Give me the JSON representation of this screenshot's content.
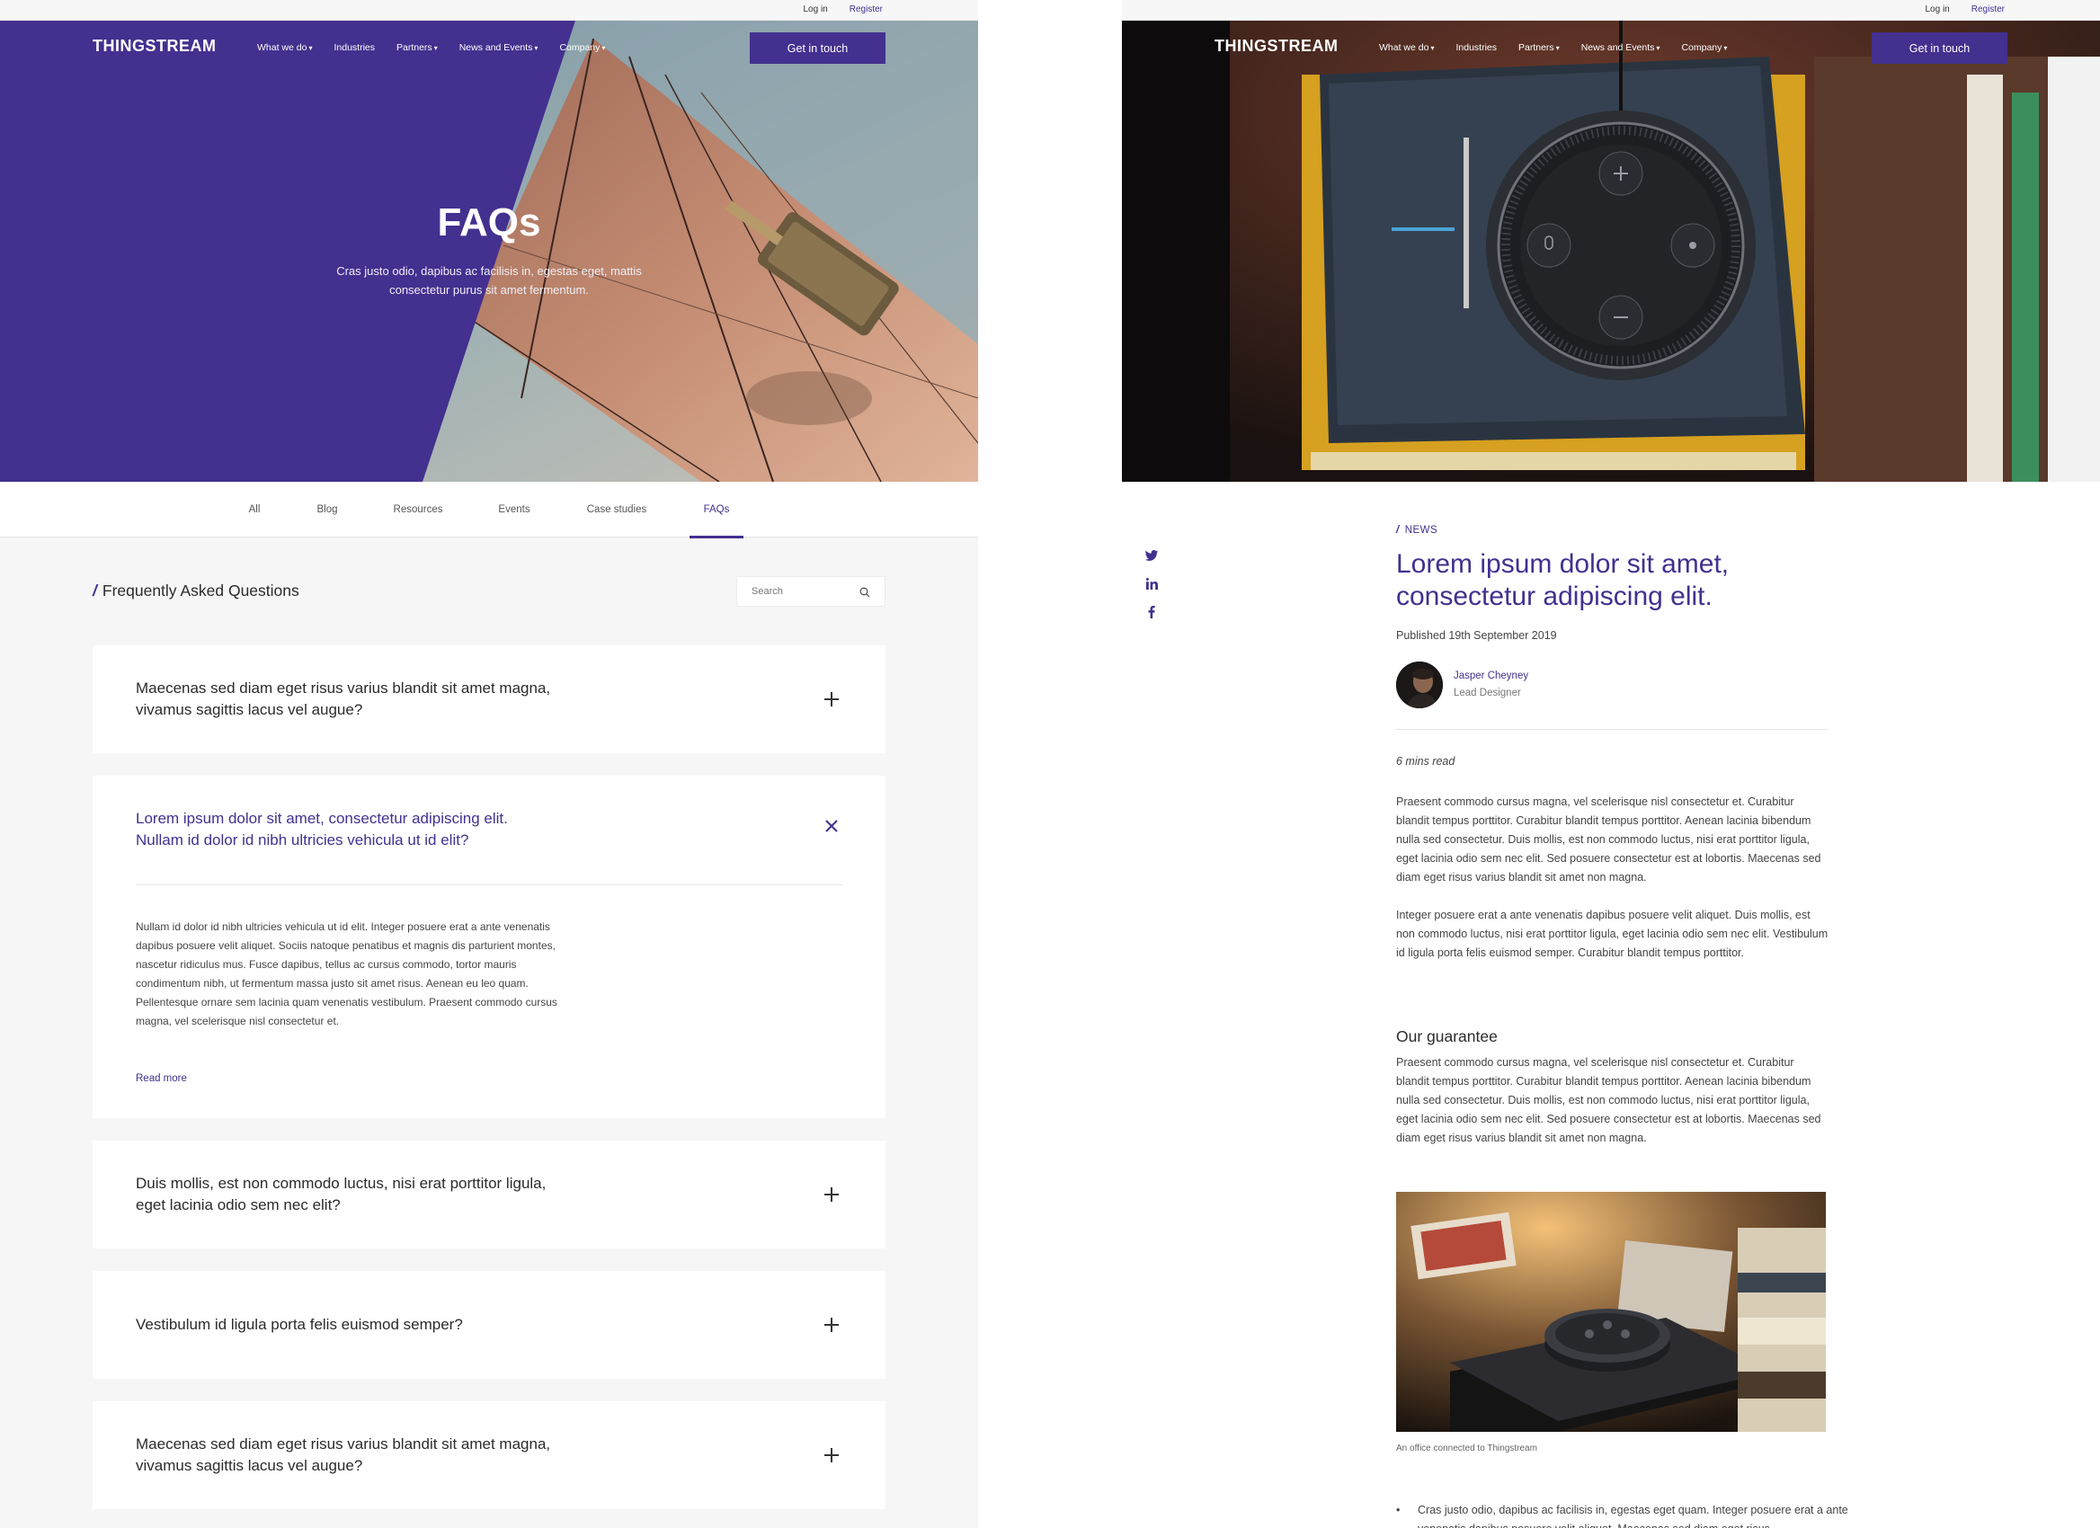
{
  "topbar": {
    "login": "Log in",
    "register": "Register"
  },
  "nav": {
    "logo": "THINGSTREAM",
    "items": [
      {
        "label": "What we do",
        "has_menu": true
      },
      {
        "label": "Industries",
        "has_menu": false
      },
      {
        "label": "Partners",
        "has_menu": true
      },
      {
        "label": "News and Events",
        "has_menu": true
      },
      {
        "label": "Company",
        "has_menu": true
      }
    ],
    "cta": "Get in touch"
  },
  "faq_page": {
    "hero": {
      "title": "FAQs",
      "subtitle": "Cras justo odio, dapibus ac facilisis in, egestas eget, mattis consectetur purus sit amet fermentum."
    },
    "tabs": [
      {
        "label": "All",
        "active": false
      },
      {
        "label": "Blog",
        "active": false
      },
      {
        "label": "Resources",
        "active": false
      },
      {
        "label": "Events",
        "active": false
      },
      {
        "label": "Case studies",
        "active": false
      },
      {
        "label": "FAQs",
        "active": true
      }
    ],
    "section_title": "Frequently Asked Questions",
    "search_placeholder": "Search",
    "items": [
      {
        "question": "Maecenas sed diam eget risus varius blandit sit amet magna, vivamus sagittis lacus vel augue?",
        "open": false
      },
      {
        "question": "Lorem ipsum dolor sit amet, consectetur adipiscing elit. Nullam id dolor id nibh ultricies vehicula ut id elit?",
        "open": true,
        "answer": "Nullam id dolor id nibh ultricies vehicula ut id elit. Integer posuere erat a ante venenatis dapibus posuere velit aliquet. Sociis natoque penatibus et magnis dis parturient montes, nascetur ridiculus mus. Fusce dapibus, tellus ac cursus commodo, tortor mauris condimentum nibh, ut fermentum massa justo sit amet risus. Aenean eu leo quam. Pellentesque ornare sem lacinia quam venenatis vestibulum. Praesent commodo cursus magna, vel scelerisque nisl consectetur et.",
        "read_more": "Read more"
      },
      {
        "question": "Duis mollis, est non commodo luctus, nisi erat porttitor ligula, eget lacinia odio sem nec elit?",
        "open": false
      },
      {
        "question": "Vestibulum id ligula porta felis euismod semper?",
        "open": false
      },
      {
        "question": "Maecenas sed diam eget risus varius blandit sit amet magna, vivamus sagittis lacus vel augue?",
        "open": false
      }
    ]
  },
  "article_page": {
    "category": "NEWS",
    "title": "Lorem ipsum dolor sit amet, consectetur adipiscing elit.",
    "published": "Published 19th September 2019",
    "author": {
      "name": "Jasper Cheyney",
      "role": "Lead Designer"
    },
    "read_time": "6 mins read",
    "paragraphs": [
      "Praesent commodo cursus magna, vel scelerisque nisl consectetur et. Curabitur blandit tempus porttitor. Curabitur blandit tempus porttitor. Aenean lacinia bibendum nulla sed consectetur. Duis mollis, est non commodo luctus, nisi erat porttitor ligula, eget lacinia odio sem nec elit. Sed posuere consectetur est at lobortis. Maecenas sed diam eget risus varius blandit sit amet non magna.",
      "Integer posuere erat a ante venenatis dapibus posuere velit aliquet. Duis mollis, est non commodo luctus, nisi erat porttitor ligula, eget lacinia odio sem nec elit. Vestibulum id ligula porta felis euismod semper. Curabitur blandit tempus porttitor."
    ],
    "subheading": "Our guarantee",
    "guarantee_text": "Praesent commodo cursus magna, vel scelerisque nisl consectetur et. Curabitur blandit tempus porttitor. Curabitur blandit tempus porttitor. Aenean lacinia bibendum nulla sed consectetur. Duis mollis, est non commodo luctus, nisi erat porttitor ligula, eget lacinia odio sem nec elit. Sed posuere consectetur est at lobortis. Maecenas sed diam eget risus varius blandit sit amet non magna.",
    "image_caption": "An office connected to Thingstream",
    "bullet": "Cras justo odio, dapibus ac facilisis in, egestas eget quam. Integer posuere erat a ante venenatis dapibus posuere velit aliquet. Maecenas sed diam eget risus",
    "social": [
      "twitter-icon",
      "linkedin-icon",
      "facebook-icon"
    ]
  },
  "colors": {
    "brand": "#43308f",
    "page_bg": "#f6f6f6",
    "text": "#2b2b2b"
  }
}
